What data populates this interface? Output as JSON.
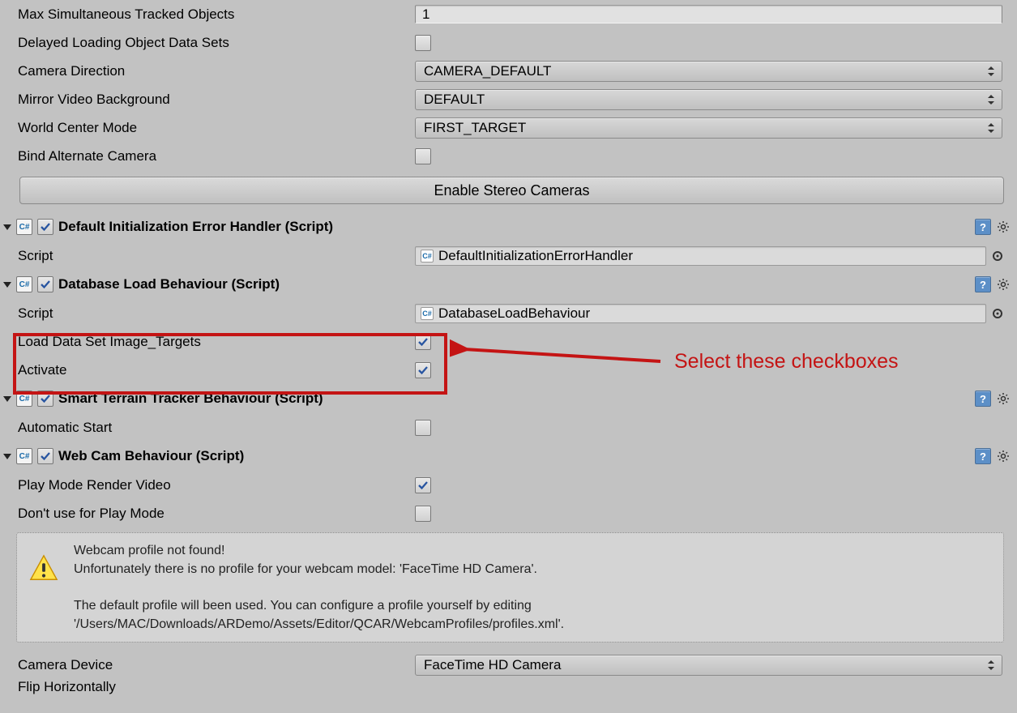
{
  "vuforia": {
    "maxTracked": {
      "label": "Max Simultaneous Tracked Objects",
      "value": "1"
    },
    "delayedLoading": {
      "label": "Delayed Loading Object Data Sets",
      "checked": false
    },
    "cameraDirection": {
      "label": "Camera Direction",
      "value": "CAMERA_DEFAULT"
    },
    "mirrorVideo": {
      "label": "Mirror Video Background",
      "value": "DEFAULT"
    },
    "worldCenter": {
      "label": "World Center Mode",
      "value": "FIRST_TARGET"
    },
    "bindAlternate": {
      "label": "Bind Alternate Camera",
      "checked": false
    },
    "enableStereo": "Enable Stereo Cameras"
  },
  "components": {
    "errorHandler": {
      "title": "Default Initialization Error Handler (Script)",
      "scriptLabel": "Script",
      "scriptValue": "DefaultInitializationErrorHandler"
    },
    "databaseLoad": {
      "title": "Database Load Behaviour (Script)",
      "scriptLabel": "Script",
      "scriptValue": "DatabaseLoadBehaviour",
      "loadDataSet": {
        "label": "Load Data Set Image_Targets",
        "checked": true
      },
      "activate": {
        "label": "Activate",
        "checked": true
      }
    },
    "smartTerrain": {
      "title": "Smart Terrain Tracker Behaviour (Script)",
      "autoStart": {
        "label": "Automatic Start",
        "checked": false
      }
    },
    "webcam": {
      "title": "Web Cam Behaviour (Script)",
      "playModeRender": {
        "label": "Play Mode Render Video",
        "checked": true
      },
      "dontUsePlayMode": {
        "label": "Don't use for Play Mode",
        "checked": false
      },
      "warning": {
        "line1": "Webcam profile not found!",
        "line2": "Unfortunately there is no profile for your webcam model: 'FaceTime HD Camera'.",
        "line3": "The default profile will been used. You can configure a profile yourself by editing",
        "line4": "'/Users/MAC/Downloads/ARDemo/Assets/Editor/QCAR/WebcamProfiles/profiles.xml'."
      },
      "cameraDevice": {
        "label": "Camera Device",
        "value": "FaceTime HD Camera"
      },
      "flipH": {
        "label": "Flip Horizontally"
      }
    }
  },
  "annotation": {
    "text": "Select these checkboxes"
  }
}
